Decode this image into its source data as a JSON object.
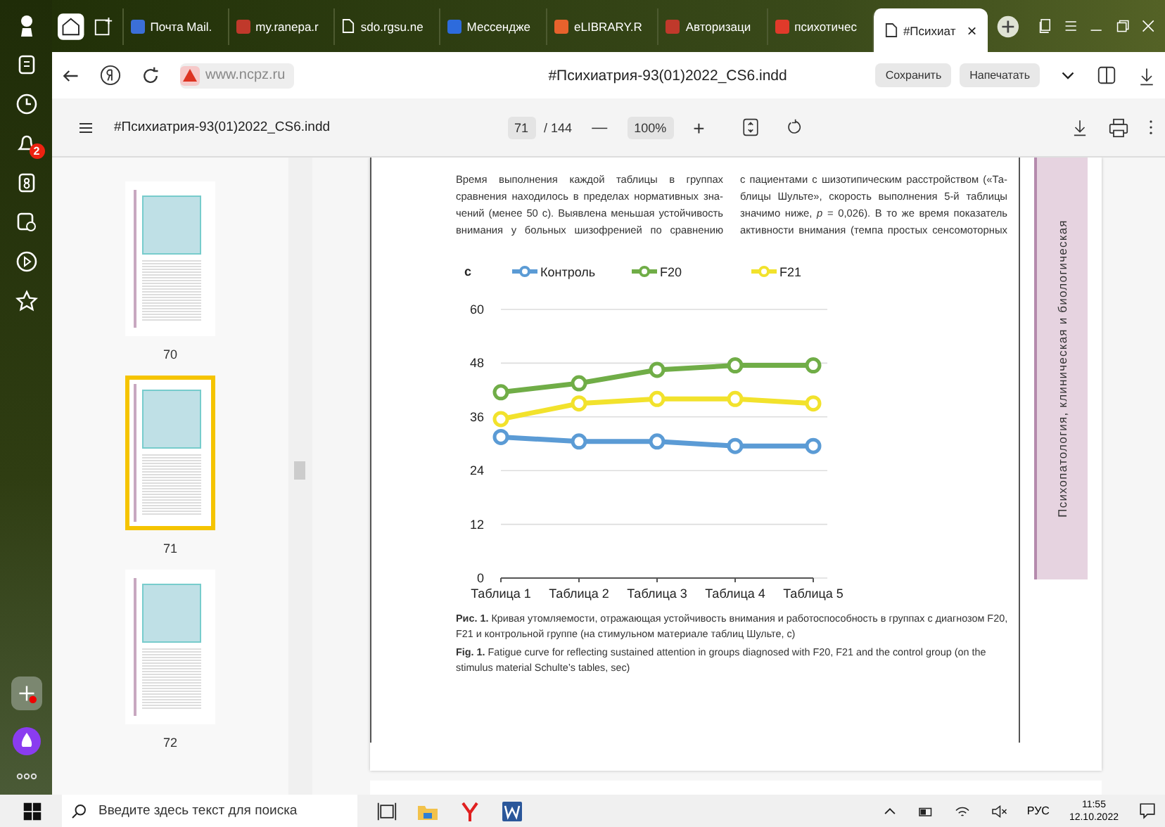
{
  "browser_tabs": [
    {
      "label": "Почта Mail.",
      "selected": false
    },
    {
      "label": "my.ranepa.r",
      "selected": false
    },
    {
      "label": "sdo.rgsu.ne",
      "selected": false
    },
    {
      "label": "Мессендже",
      "selected": false
    },
    {
      "label": "eLIBRARY.R",
      "selected": false
    },
    {
      "label": "Авторизаци",
      "selected": false
    },
    {
      "label": "психотичес",
      "selected": false
    },
    {
      "label": "#Психиат",
      "selected": true,
      "close": "×"
    }
  ],
  "address_bar": {
    "url": "www.ncpz.ru",
    "title": "#Психиатрия-93(01)2022_CS6.indd",
    "buttons": [
      "Сохранить",
      "Напечатать"
    ]
  },
  "sidebar": {
    "notification_count": "2"
  },
  "pdf_toolbar": {
    "title": "#Психиатрия-93(01)2022_CS6.indd",
    "page": "71",
    "page_total": "/ 144",
    "zoom": "100%",
    "zoom_out": "—",
    "zoom_in": "+"
  },
  "thumbnails": [
    {
      "label": "70",
      "selected": false
    },
    {
      "label": "71",
      "selected": true
    },
    {
      "label": "72",
      "selected": false
    }
  ],
  "page": {
    "columns": [
      [
        "Время выполнения каждой таблицы в группах",
        "сравнения находилось в пределах нормативных зна-",
        "чений (менее 50 с). Выявлена меньшая устойчивость",
        "внимания у больных шизофренией по сравнению"
      ],
      [
        "с пациентами с шизотипическим расстройством («Та-",
        "блицы Шульте», скорость выполнения 5-й таблицы",
        "значимо ниже, *p* = 0,026). В то же время показатель",
        "активности внимания (темпа простых сенсомоторных"
      ]
    ],
    "chart_data": {
      "type": "line",
      "ylabel": "с",
      "categories": [
        "Таблица 1",
        "Таблица 2",
        "Таблица 3",
        "Таблица 4",
        "Таблица 5"
      ],
      "ylim": [
        0,
        60
      ],
      "yticks": [
        0,
        12,
        24,
        36,
        48,
        60
      ],
      "grid": true,
      "legend": true,
      "series": [
        {
          "name": "Контроль",
          "color": "#5b9bd5",
          "marker": "circle",
          "values": [
            31.5,
            30.5,
            30.5,
            29.5,
            29.5
          ]
        },
        {
          "name": "F20",
          "color": "#70ad47",
          "marker": "circle",
          "values": [
            41.5,
            43.5,
            46.5,
            47.5,
            47.5
          ]
        },
        {
          "name": "F21",
          "color": "#f2e22c",
          "marker": "circle",
          "values": [
            35.5,
            39,
            40,
            40,
            39
          ]
        }
      ]
    },
    "caption_ru": "**Рис. 1.** Кривая утомляемости, отражающая устойчивость внимания и работоспособность в группах с диагнозом F20, F21 и контрольной группе (на стимульном материале таблиц Шульте, с)",
    "caption_en": "**Fig. 1.** Fatigue curve for reflecting sustained attention in groups diagnosed with F20, F21 and the control group (on the stimulus material Schulte’s tables, sec)",
    "side_heading": "Психопатология, клиническая и биологическая"
  },
  "taskbar": {
    "search_placeholder": "Введите здесь текст для поиска",
    "language": "РУС",
    "time": "11:55",
    "date": "12.10.2022"
  }
}
